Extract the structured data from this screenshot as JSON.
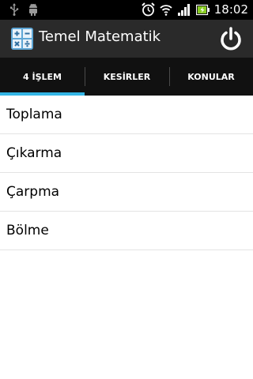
{
  "status_bar": {
    "time": "18:02",
    "icons": [
      "usb-icon",
      "android-debug-icon",
      "alarm-icon",
      "wifi-icon",
      "signal-icon",
      "battery-icon"
    ]
  },
  "action_bar": {
    "title": "Temel Matematik",
    "app_icon": "calculator-icon",
    "action_icon": "power-icon"
  },
  "tabs": [
    {
      "label": "4 İŞLEM",
      "selected": true
    },
    {
      "label": "KESİRLER",
      "selected": false
    },
    {
      "label": "KONULAR",
      "selected": false
    }
  ],
  "list": {
    "items": [
      {
        "label": "Toplama"
      },
      {
        "label": "Çıkarma"
      },
      {
        "label": "Çarpma"
      },
      {
        "label": "Bölme"
      }
    ]
  },
  "colors": {
    "accent": "#33b5e5",
    "action_bar": "#2a2a2a",
    "tab_bar": "#111111",
    "status_bar": "#000000"
  }
}
